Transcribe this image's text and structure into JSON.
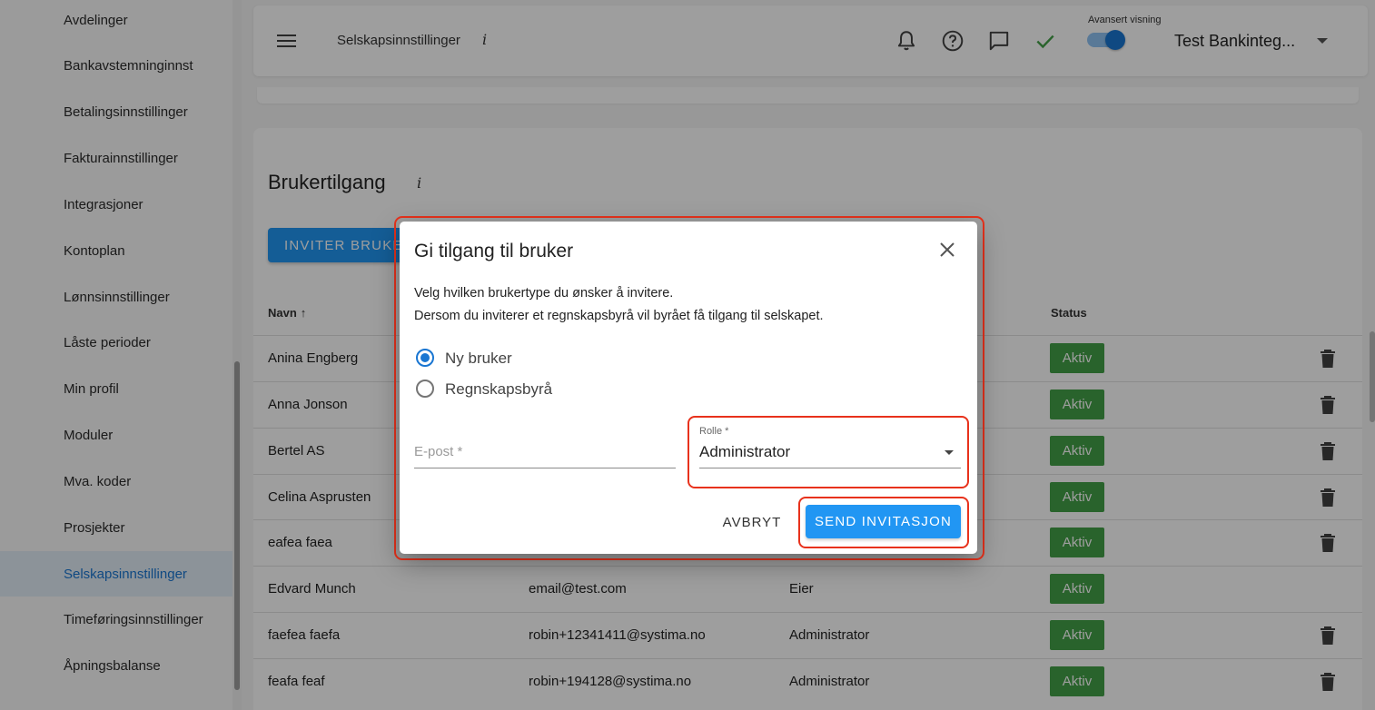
{
  "sidebar": {
    "items": [
      {
        "label": "Avdelinger",
        "active": false
      },
      {
        "label": "Bankavstemninginnst",
        "active": false
      },
      {
        "label": "Betalingsinnstillinger",
        "active": false
      },
      {
        "label": "Fakturainnstillinger",
        "active": false
      },
      {
        "label": "Integrasjoner",
        "active": false
      },
      {
        "label": "Kontoplan",
        "active": false
      },
      {
        "label": "Lønnsinnstillinger",
        "active": false
      },
      {
        "label": "Låste perioder",
        "active": false
      },
      {
        "label": "Min profil",
        "active": false
      },
      {
        "label": "Moduler",
        "active": false
      },
      {
        "label": "Mva. koder",
        "active": false
      },
      {
        "label": "Prosjekter",
        "active": false
      },
      {
        "label": "Selskapsinnstillinger",
        "active": true
      },
      {
        "label": "Timeføringsinnstillinger",
        "active": false
      },
      {
        "label": "Åpningsbalanse",
        "active": false
      }
    ]
  },
  "header": {
    "title": "Selskapsinnstillinger",
    "info": "i",
    "advanced_view_label": "Avansert visning",
    "advanced_view_on": true,
    "company_name": "Test Bankinteg..."
  },
  "card": {
    "title": "Brukertilgang",
    "info": "i",
    "invite_button": "INVITER BRUKER"
  },
  "table": {
    "columns": {
      "name": "Navn",
      "status": "Status"
    },
    "rows": [
      {
        "name": "Anina Engberg",
        "email": "",
        "role": "",
        "status": "Aktiv",
        "deletable": true
      },
      {
        "name": "Anna Jonson",
        "email": "",
        "role": "",
        "status": "Aktiv",
        "deletable": true
      },
      {
        "name": "Bertel AS",
        "email": "",
        "role": "",
        "status": "Aktiv",
        "deletable": true
      },
      {
        "name": "Celina Asprusten",
        "email": "",
        "role": "",
        "status": "Aktiv",
        "deletable": true
      },
      {
        "name": "eafea faea",
        "email": "",
        "role": "",
        "status": "Aktiv",
        "deletable": true
      },
      {
        "name": "Edvard Munch",
        "email": "email@test.com",
        "role": "Eier",
        "status": "Aktiv",
        "deletable": false
      },
      {
        "name": "faefea faefa",
        "email": "robin+12341411@systima.no",
        "role": "Administrator",
        "status": "Aktiv",
        "deletable": true
      },
      {
        "name": "feafa feaf",
        "email": "robin+194128@systima.no",
        "role": "Administrator",
        "status": "Aktiv",
        "deletable": true
      }
    ]
  },
  "dialog": {
    "title": "Gi tilgang til bruker",
    "description_line1": "Velg hvilken brukertype du ønsker å invitere.",
    "description_line2": "Dersom du inviterer et regnskapsbyrå vil byrået få tilgang til selskapet.",
    "options": [
      {
        "label": "Ny bruker",
        "checked": true
      },
      {
        "label": "Regnskapsbyrå",
        "checked": false
      }
    ],
    "email_placeholder": "E-post *",
    "email_value": "",
    "role_label": "Rolle *",
    "role_value": "Administrator",
    "cancel_label": "AVBRYT",
    "send_label": "SEND INVITASJON"
  },
  "colors": {
    "primary": "#2196f3",
    "active_text": "#1976d2",
    "status_active": "#43a047",
    "highlight": "#e8321c"
  }
}
